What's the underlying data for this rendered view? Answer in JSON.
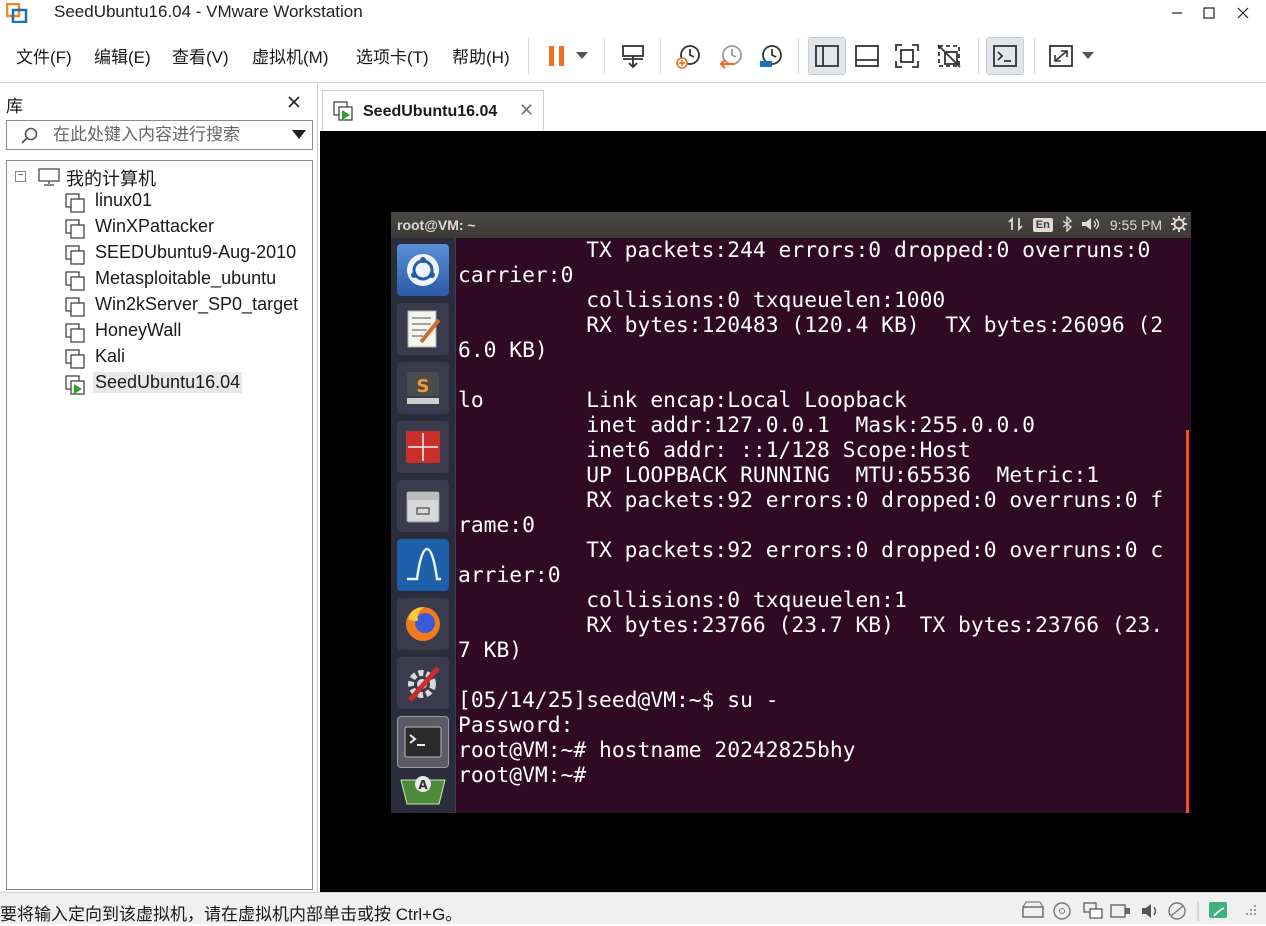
{
  "window": {
    "title": "SeedUbuntu16.04 - VMware Workstation",
    "logo_icon": "vmware-logo-icon",
    "controls": [
      "minimize-icon",
      "maximize-icon",
      "close-icon"
    ]
  },
  "menu": {
    "items": [
      "文件(F)",
      "编辑(E)",
      "查看(V)",
      "虚拟机(M)",
      "选项卡(T)",
      "帮助(H)"
    ]
  },
  "toolbar": {
    "icons": [
      "pause-icon",
      "dropdown-icon",
      "send-ctrl-alt-del-icon",
      "snapshot-take-icon",
      "snapshot-revert-icon",
      "snapshot-manager-icon",
      "library-view-icon",
      "thumbnail-bar-icon",
      "fullscreen-icon",
      "unity-icon",
      "console-view-icon",
      "stretch-icon",
      "dropdown-icon"
    ],
    "accent_color": "#f0701e"
  },
  "library": {
    "title": "库",
    "search_placeholder": "在此处键入内容进行搜索",
    "root": {
      "label": "我的计算机",
      "expander": "⊟"
    },
    "vms": [
      {
        "label": "linux01",
        "running": false
      },
      {
        "label": "WinXPattacker",
        "running": false
      },
      {
        "label": "SEEDUbuntu9-Aug-2010",
        "running": false
      },
      {
        "label": "Metasploitable_ubuntu",
        "running": false
      },
      {
        "label": "Win2kServer_SP0_target",
        "running": false
      },
      {
        "label": "HoneyWall",
        "running": false
      },
      {
        "label": "Kali",
        "running": false
      },
      {
        "label": "SeedUbuntu16.04",
        "running": true,
        "selected": true
      }
    ]
  },
  "tab": {
    "label": "SeedUbuntu16.04",
    "close": "✕"
  },
  "guest": {
    "window_title": "root@VM: ~",
    "indicators": {
      "keyboard": "En",
      "time": "9:55 PM"
    },
    "launcher_icons": [
      "ubuntu-dash-icon",
      "text-editor-icon",
      "sublime-text-icon",
      "terminator-icon",
      "file-manager-icon",
      "wireshark-icon",
      "firefox-icon",
      "system-settings-icon",
      "terminal-icon",
      "software-updater-icon"
    ],
    "terminal_lines": [
      "          TX packets:244 errors:0 dropped:0 overruns:0",
      "carrier:0",
      "          collisions:0 txqueuelen:1000",
      "          RX bytes:120483 (120.4 KB)  TX bytes:26096 (2",
      "6.0 KB)",
      "",
      "lo        Link encap:Local Loopback",
      "          inet addr:127.0.0.1  Mask:255.0.0.0",
      "          inet6 addr: ::1/128 Scope:Host",
      "          UP LOOPBACK RUNNING  MTU:65536  Metric:1",
      "          RX packets:92 errors:0 dropped:0 overruns:0 f",
      "rame:0",
      "          TX packets:92 errors:0 dropped:0 overruns:0 c",
      "arrier:0",
      "          collisions:0 txqueuelen:1",
      "          RX bytes:23766 (23.7 KB)  TX bytes:23766 (23.",
      "7 KB)",
      "",
      "[05/14/25]seed@VM:~$ su -",
      "Password:",
      "root@VM:~# hostname 20242825bhy",
      "root@VM:~# "
    ],
    "colors": {
      "terminal_bg": "#300a24",
      "launcher_bg": "#2c2d3c",
      "scroll_accent": "#e95420"
    }
  },
  "status": {
    "text": "要将输入定向到该虚拟机，请在虚拟机内部单击或按 Ctrl+G。",
    "device_icons": [
      "hard-disk-icon",
      "cd-rom-icon",
      "network-adapter-icon",
      "usb-icon",
      "sound-card-icon",
      "printer-icon",
      "display-icon",
      "message-icon"
    ]
  }
}
